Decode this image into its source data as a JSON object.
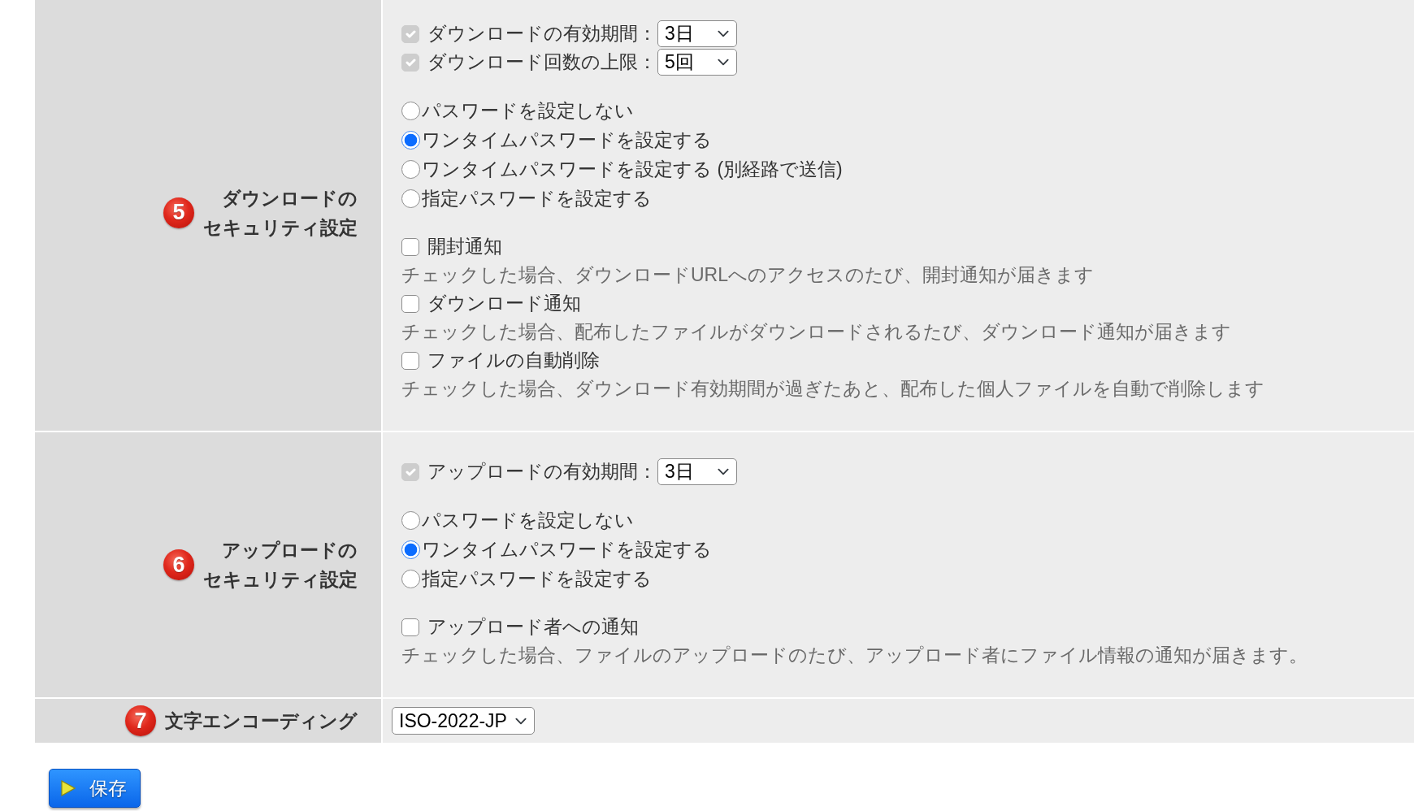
{
  "sections": [
    {
      "number": "5",
      "label_lines": [
        "ダウンロードの",
        "セキュリティ設定"
      ],
      "groups": [
        {
          "kind": "limits",
          "items": [
            {
              "checked": true,
              "disabled": true,
              "label": "ダウンロードの有効期間：",
              "value": "3日"
            },
            {
              "checked": true,
              "disabled": true,
              "label": "ダウンロード回数の上限：",
              "value": "5回"
            }
          ]
        },
        {
          "kind": "passwords",
          "options": [
            {
              "label": "パスワードを設定しない",
              "selected": false
            },
            {
              "label": "ワンタイムパスワードを設定する",
              "selected": true
            },
            {
              "label": "ワンタイムパスワードを設定する (別経路で送信)",
              "selected": false
            },
            {
              "label": "指定パスワードを設定する",
              "selected": false
            }
          ]
        },
        {
          "kind": "notifications",
          "items": [
            {
              "label": "開封通知",
              "checked": false,
              "description": "チェックした場合、ダウンロードURLへのアクセスのたび、開封通知が届きます"
            },
            {
              "label": "ダウンロード通知",
              "checked": false,
              "description": "チェックした場合、配布したファイルがダウンロードされるたび、ダウンロード通知が届きます"
            },
            {
              "label": "ファイルの自動削除",
              "checked": false,
              "description": "チェックした場合、ダウンロード有効期間が過ぎたあと、配布した個人ファイルを自動で削除します"
            }
          ]
        }
      ]
    },
    {
      "number": "6",
      "label_lines": [
        "アップロードの",
        "セキュリティ設定"
      ],
      "groups": [
        {
          "kind": "limits",
          "items": [
            {
              "checked": true,
              "disabled": true,
              "label": "アップロードの有効期間：",
              "value": "3日"
            }
          ]
        },
        {
          "kind": "passwords",
          "options": [
            {
              "label": "パスワードを設定しない",
              "selected": false
            },
            {
              "label": "ワンタイムパスワードを設定する",
              "selected": true
            },
            {
              "label": "指定パスワードを設定する",
              "selected": false
            }
          ]
        },
        {
          "kind": "notifications",
          "items": [
            {
              "label": "アップロード者への通知",
              "checked": false,
              "description": "チェックした場合、ファイルのアップロードのたび、アップロード者にファイル情報の通知が届きます。"
            }
          ]
        }
      ]
    },
    {
      "number": "7",
      "label_lines": [
        "文字エンコーディング"
      ],
      "groups": [
        {
          "kind": "select",
          "value": "ISO-2022-JP"
        }
      ]
    }
  ],
  "save_button": {
    "label": "保存"
  }
}
